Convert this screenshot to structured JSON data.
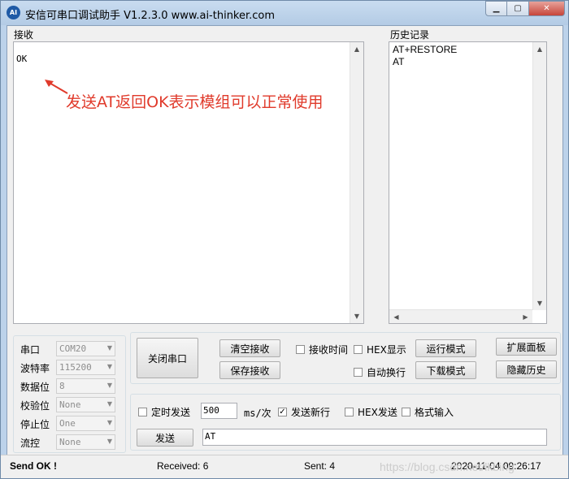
{
  "window": {
    "icon_text": "AI",
    "title": "安信可串口调试助手 V1.2.3.0    www.ai-thinker.com",
    "minimize_glyph": "▁",
    "maximize_glyph": "▢",
    "close_glyph": "✕"
  },
  "receive": {
    "label": "接收",
    "text": "OK",
    "annotation": "发送AT返回OK表示模组可以正常使用"
  },
  "history": {
    "label": "历史记录",
    "items": [
      "AT+RESTORE",
      "AT"
    ]
  },
  "serial": {
    "rows": [
      {
        "label": "串口",
        "value": "COM20"
      },
      {
        "label": "波特率",
        "value": "115200"
      },
      {
        "label": "数据位",
        "value": "8"
      },
      {
        "label": "校验位",
        "value": "None"
      },
      {
        "label": "停止位",
        "value": "One"
      },
      {
        "label": "流控",
        "value": "None"
      }
    ]
  },
  "buttons": {
    "close_port": "关闭串口",
    "clear_recv": "清空接收",
    "save_recv": "保存接收",
    "run_mode": "运行模式",
    "download_mode": "下载模式",
    "expand_panel": "扩展面板",
    "hide_history": "隐藏历史",
    "send": "发送"
  },
  "options": {
    "recv_time": "接收时间",
    "hex_display": "HEX显示",
    "auto_wrap": "自动换行",
    "timed_send": "定时发送",
    "interval": "500",
    "interval_unit": "ms/次",
    "send_newline": "发送新行",
    "hex_send": "HEX发送",
    "format_input": "格式输入",
    "send_text": "AT"
  },
  "status": {
    "result": "Send OK !",
    "received": "Received: 6",
    "sent": "Sent: 4",
    "datetime": "2020-11-04 09:26:17"
  },
  "watermark": "https://blog.csdn.net/lkbing"
}
